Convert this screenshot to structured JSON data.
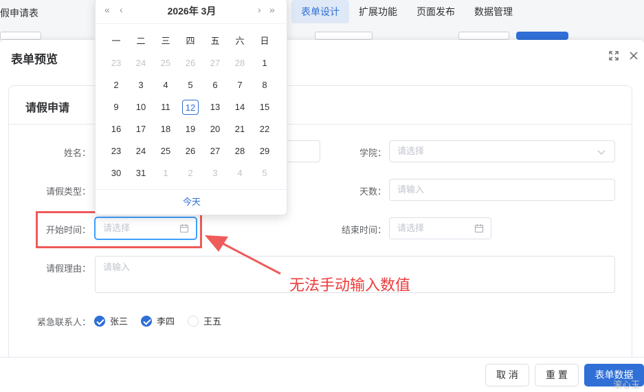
{
  "app": {
    "title": "假申请表",
    "nav": [
      "表单设计",
      "扩展功能",
      "页面发布",
      "数据管理"
    ],
    "active_nav": 0
  },
  "modal": {
    "title": "表单预览",
    "card_title": "请假申请",
    "fields": {
      "name_label": "姓名：",
      "college_label": "学院：",
      "college_placeholder": "请选择",
      "leave_type_label": "请假类型：",
      "days_label": "天数：",
      "days_placeholder": "请输入",
      "start_label": "开始时间：",
      "start_placeholder": "请选择",
      "end_label": "结束时间：",
      "end_placeholder": "请选择",
      "reason_label": "请假理由：",
      "reason_placeholder": "请输入",
      "contacts_label": "紧急联系人："
    },
    "contacts": [
      {
        "label": "张三",
        "checked": true
      },
      {
        "label": "李四",
        "checked": true
      },
      {
        "label": "王五",
        "checked": false
      }
    ],
    "buttons": {
      "cancel": "取 消",
      "reset": "重 置",
      "data": "表单数据"
    }
  },
  "date_picker": {
    "title": "2026年  3月",
    "prev_year": "«",
    "prev_month": "‹",
    "next_month": "›",
    "next_year": "»",
    "weekdays": [
      "一",
      "二",
      "三",
      "四",
      "五",
      "六",
      "日"
    ],
    "weeks": [
      [
        {
          "d": "23",
          "m": true
        },
        {
          "d": "24",
          "m": true
        },
        {
          "d": "25",
          "m": true
        },
        {
          "d": "26",
          "m": true
        },
        {
          "d": "27",
          "m": true
        },
        {
          "d": "28",
          "m": true
        },
        {
          "d": "1",
          "m": false
        }
      ],
      [
        {
          "d": "2",
          "m": false
        },
        {
          "d": "3",
          "m": false
        },
        {
          "d": "4",
          "m": false
        },
        {
          "d": "5",
          "m": false
        },
        {
          "d": "6",
          "m": false
        },
        {
          "d": "7",
          "m": false
        },
        {
          "d": "8",
          "m": false
        }
      ],
      [
        {
          "d": "9",
          "m": false
        },
        {
          "d": "10",
          "m": false
        },
        {
          "d": "11",
          "m": false
        },
        {
          "d": "12",
          "m": false,
          "today": true
        },
        {
          "d": "13",
          "m": false
        },
        {
          "d": "14",
          "m": false
        },
        {
          "d": "15",
          "m": false
        }
      ],
      [
        {
          "d": "16",
          "m": false
        },
        {
          "d": "17",
          "m": false
        },
        {
          "d": "18",
          "m": false
        },
        {
          "d": "19",
          "m": false
        },
        {
          "d": "20",
          "m": false
        },
        {
          "d": "21",
          "m": false
        },
        {
          "d": "22",
          "m": false
        }
      ],
      [
        {
          "d": "23",
          "m": false
        },
        {
          "d": "24",
          "m": false
        },
        {
          "d": "25",
          "m": false
        },
        {
          "d": "26",
          "m": false
        },
        {
          "d": "27",
          "m": false
        },
        {
          "d": "28",
          "m": false
        },
        {
          "d": "29",
          "m": false
        }
      ],
      [
        {
          "d": "30",
          "m": false
        },
        {
          "d": "31",
          "m": false
        },
        {
          "d": "1",
          "m": true
        },
        {
          "d": "2",
          "m": true
        },
        {
          "d": "3",
          "m": true
        },
        {
          "d": "4",
          "m": true
        },
        {
          "d": "5",
          "m": true
        }
      ]
    ],
    "today_label": "今天"
  },
  "annotation": {
    "text": "无法手动输入数值",
    "color": "#ef3b3b"
  },
  "watermark": "滚心玉",
  "colors": {
    "primary": "#2f6fd6",
    "annotation": "#ef5a5a"
  }
}
